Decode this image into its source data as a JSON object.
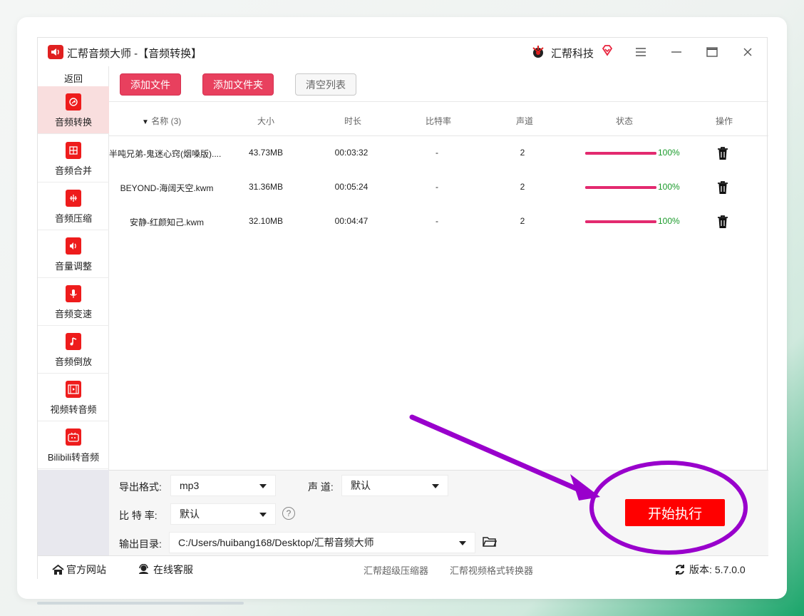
{
  "window": {
    "title": "汇帮音频大师 -【音频转换】",
    "brand": "汇帮科技"
  },
  "sidebar": {
    "back_label": "返回",
    "items": [
      {
        "label": "音频转换",
        "icon": "audio-convert-icon"
      },
      {
        "label": "音频合并",
        "icon": "audio-merge-icon"
      },
      {
        "label": "音频压缩",
        "icon": "audio-compress-icon"
      },
      {
        "label": "音量调整",
        "icon": "volume-icon"
      },
      {
        "label": "音频变速",
        "icon": "microphone-icon"
      },
      {
        "label": "音频倒放",
        "icon": "music-note-icon"
      },
      {
        "label": "视频转音频",
        "icon": "film-icon"
      },
      {
        "label": "Bilibili转音频",
        "icon": "tv-icon"
      }
    ]
  },
  "toolbar": {
    "add_file": "添加文件",
    "add_folder": "添加文件夹",
    "clear_list": "清空列表"
  },
  "table": {
    "headers": {
      "name": "名称 (3)",
      "size": "大小",
      "duration": "时长",
      "bitrate": "比特率",
      "channels": "声道",
      "status": "状态",
      "action": "操作"
    },
    "rows": [
      {
        "name": "半吨兄弟-鬼迷心窍(烟嗓版)....",
        "size": "43.73MB",
        "duration": "00:03:32",
        "bitrate": "-",
        "channels": "2",
        "progress": 100,
        "progress_label": "100%"
      },
      {
        "name": "BEYOND-海阔天空.kwm",
        "size": "31.36MB",
        "duration": "00:05:24",
        "bitrate": "-",
        "channels": "2",
        "progress": 100,
        "progress_label": "100%"
      },
      {
        "name": "安静-红颜知己.kwm",
        "size": "32.10MB",
        "duration": "00:04:47",
        "bitrate": "-",
        "channels": "2",
        "progress": 100,
        "progress_label": "100%"
      }
    ]
  },
  "settings": {
    "format_label": "导出格式:",
    "format_value": "mp3",
    "channel_label": "声 道:",
    "channel_value": "默认",
    "bitrate_label": "比 特 率:",
    "bitrate_value": "默认",
    "help_glyph": "?",
    "output_label": "输出目录:",
    "output_value": "C:/Users/huibang168/Desktop/汇帮音频大师",
    "start_button": "开始执行"
  },
  "footer": {
    "website": "官方网站",
    "support": "在线客服",
    "link1": "汇帮超级压缩器",
    "link2": "汇帮视频格式转换器",
    "version_label": "版本:",
    "version": "5.7.0.0"
  },
  "colors": {
    "accent_red": "#e8405e",
    "start_red": "#ff0000",
    "progress": "#e32a6f",
    "annotation_purple": "#9900cc"
  }
}
